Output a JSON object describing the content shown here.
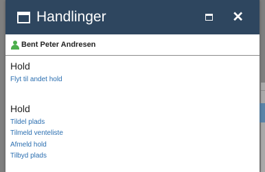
{
  "dialog": {
    "title": "Handlinger",
    "title_icon": "window-icon",
    "maximize_icon": "maximize-icon",
    "close_icon": "close-icon",
    "close_glyph": "✕"
  },
  "user": {
    "icon": "user-icon",
    "name": "Bent Peter Andresen"
  },
  "sections": [
    {
      "title": "Hold",
      "links": [
        "Flyt til andet hold"
      ]
    },
    {
      "title": "Hold",
      "links": [
        "Tildel plads",
        "Tilmeld venteliste",
        "Afmeld hold",
        "Tilbyd plads"
      ]
    }
  ],
  "colors": {
    "titlebar": "#2e465f",
    "link": "#2a6eb0",
    "user_icon": "#4cae4c",
    "overlay": "#7f7f7f"
  }
}
